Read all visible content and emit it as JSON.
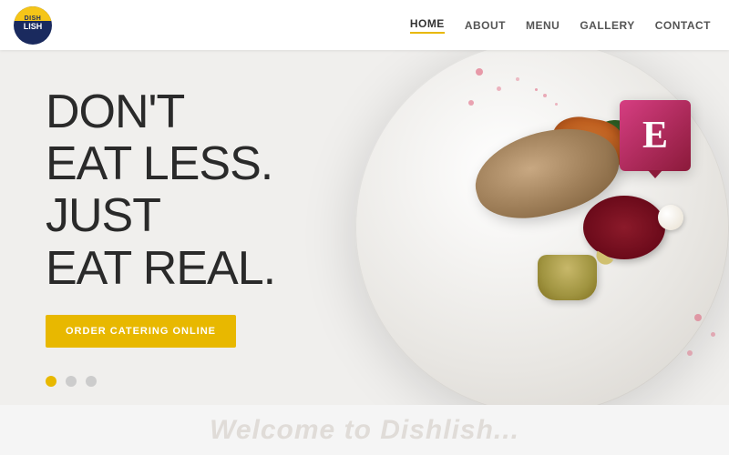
{
  "header": {
    "logo": {
      "top_text": "DISH",
      "bottom_text": "LISH",
      "alt": "DishLish Logo"
    },
    "nav": {
      "items": [
        {
          "id": "home",
          "label": "HOME",
          "active": true
        },
        {
          "id": "about",
          "label": "ABOUT",
          "active": false
        },
        {
          "id": "menu",
          "label": "MENU",
          "active": false
        },
        {
          "id": "gallery",
          "label": "GALLERY",
          "active": false
        },
        {
          "id": "contact",
          "label": "CONTACT",
          "active": false
        }
      ]
    }
  },
  "hero": {
    "headline_line1": "DON'T",
    "headline_line2": "EAT LESS.",
    "headline_line3": "JUST",
    "headline_line4": "EAT REAL.",
    "cta_label": "ORDER CATERING ONLINE",
    "slider_dots": [
      {
        "active": true
      },
      {
        "active": false
      },
      {
        "active": false
      }
    ]
  },
  "elementor": {
    "letter": "E"
  },
  "teaser": {
    "text": "Welcome to Dishlish..."
  }
}
